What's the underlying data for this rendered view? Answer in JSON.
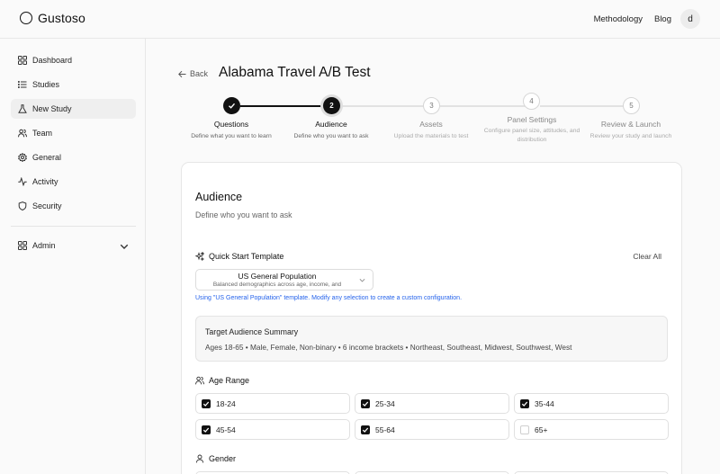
{
  "app": {
    "name": "Gustoso"
  },
  "topnav": {
    "methodology": "Methodology",
    "blog": "Blog",
    "avatar_initial": "d"
  },
  "sidebar": {
    "items": [
      {
        "label": "Dashboard",
        "icon": "grid-icon"
      },
      {
        "label": "Studies",
        "icon": "list-icon"
      },
      {
        "label": "New Study",
        "icon": "flask-icon",
        "active": true
      },
      {
        "label": "Team",
        "icon": "users-icon"
      },
      {
        "label": "General",
        "icon": "gear-icon"
      },
      {
        "label": "Activity",
        "icon": "activity-icon"
      },
      {
        "label": "Security",
        "icon": "shield-icon"
      }
    ],
    "admin": {
      "label": "Admin",
      "icon": "grid-icon"
    }
  },
  "page": {
    "back_label": "Back",
    "title": "Alabama Travel A/B Test"
  },
  "stepper": {
    "steps": [
      {
        "number": "1",
        "label": "Questions",
        "desc": "Define what you want to learn",
        "state": "done"
      },
      {
        "number": "2",
        "label": "Audience",
        "desc": "Define who you want to ask",
        "state": "current"
      },
      {
        "number": "3",
        "label": "Assets",
        "desc": "Upload the materials to test",
        "state": "todo"
      },
      {
        "number": "4",
        "label": "Panel Settings",
        "desc": "Configure panel size, attitudes, and distribution",
        "state": "todo"
      },
      {
        "number": "5",
        "label": "Review & Launch",
        "desc": "Review your study and launch",
        "state": "todo"
      }
    ]
  },
  "audience": {
    "title": "Audience",
    "subtitle": "Define who you want to ask",
    "quick_start": {
      "label": "Quick Start Template",
      "clear_all": "Clear All",
      "selected_title": "US General Population",
      "selected_desc": "Balanced demographics across age, income, and",
      "hint": "Using \"US General Population\" template. Modify any selection to create a custom configuration."
    },
    "summary": {
      "title": "Target Audience Summary",
      "text": "Ages 18-65 • Male, Female, Non-binary • 6 income brackets • Northeast, Southeast, Midwest, Southwest, West"
    },
    "age_range": {
      "label": "Age Range",
      "options": [
        {
          "label": "18-24",
          "checked": true
        },
        {
          "label": "25-34",
          "checked": true
        },
        {
          "label": "35-44",
          "checked": true
        },
        {
          "label": "45-54",
          "checked": true
        },
        {
          "label": "55-64",
          "checked": true
        },
        {
          "label": "65+",
          "checked": false
        }
      ]
    },
    "gender": {
      "label": "Gender"
    }
  },
  "colors": {
    "accent": "#111111",
    "link": "#2563eb"
  }
}
